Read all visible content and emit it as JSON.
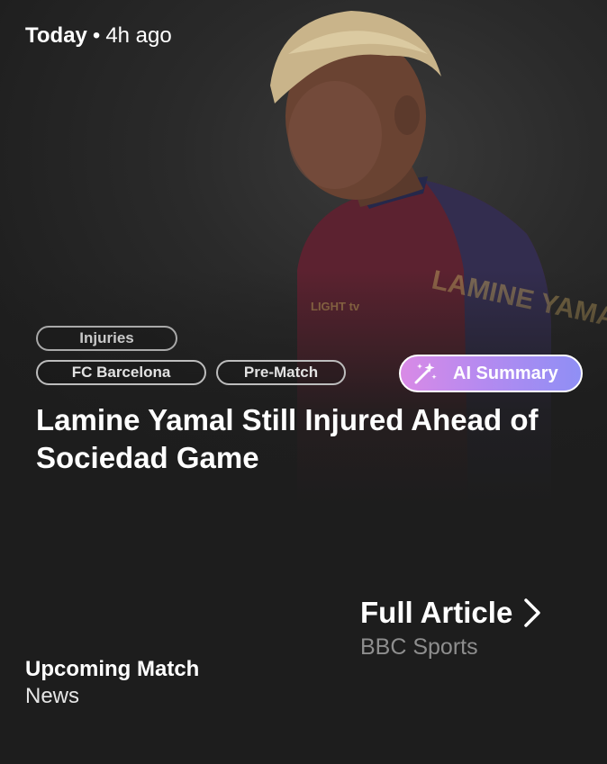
{
  "meta": {
    "day": "Today",
    "separator": "•",
    "time_ago": "4h ago"
  },
  "tags": [
    "Injuries",
    "FC Barcelona",
    "Pre-Match"
  ],
  "ai_summary": {
    "label": "AI Summary",
    "icon": "magic-wand-icon",
    "gradient": [
      "#d98ae6",
      "#8f8ff5"
    ]
  },
  "article": {
    "headline": "Lamine Yamal Still Injured Ahead of Sociedad Game",
    "full_article_label": "Full Article",
    "source": "BBC Sports"
  },
  "card": {
    "title": "Upcoming Match",
    "subtitle": "News"
  },
  "colors": {
    "background": "#1d1d1d",
    "text_secondary": "#8e8e8e"
  }
}
